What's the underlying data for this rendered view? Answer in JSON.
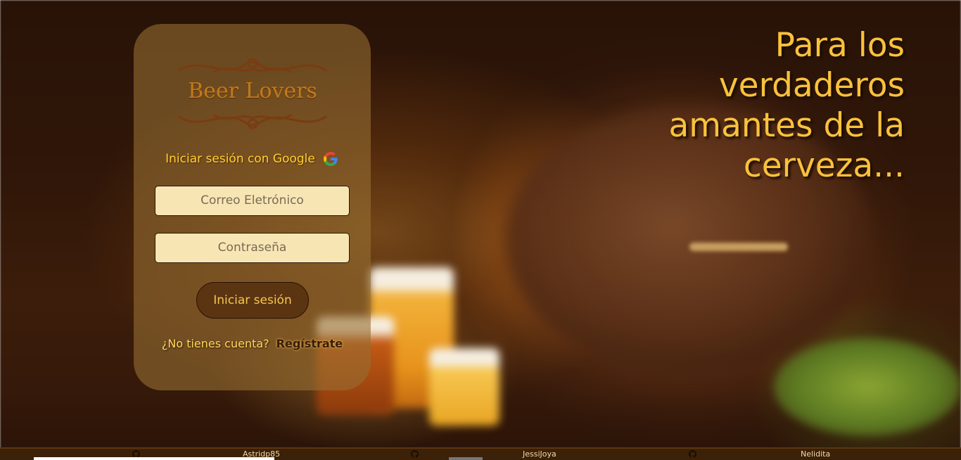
{
  "brand": {
    "logo_text": "Beer Lovers",
    "logo_icon": "ornamental-scroll-icon"
  },
  "login": {
    "google_label": "Iniciar sesión con Google",
    "google_icon": "google-icon",
    "email_placeholder": "Correo Eletrónico",
    "password_placeholder": "Contraseña",
    "submit_label": "Iniciar sesión",
    "no_account_text": "¿No tienes cuenta?",
    "register_label": "Regístrate"
  },
  "hero": {
    "headline_lines": [
      "Para los",
      "verdaderos",
      "amantes de la",
      "cerveza..."
    ]
  },
  "footer": {
    "authors": [
      {
        "name": "Astridp85",
        "icon": "github-icon"
      },
      {
        "name": "JessiJoya",
        "icon": "github-icon"
      },
      {
        "name": "Nelidita",
        "icon": "github-icon"
      }
    ]
  },
  "colors": {
    "accent": "#f9c23c",
    "button_bg": "#5b3412",
    "input_bg": "#f7e6b4",
    "footer_bg": "#3b2108"
  }
}
